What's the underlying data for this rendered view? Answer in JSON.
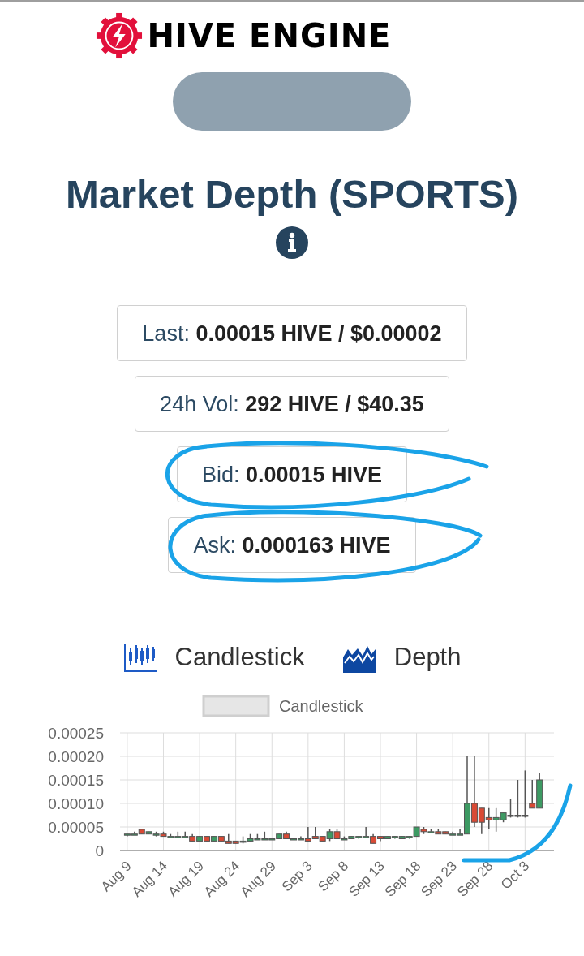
{
  "logo": {
    "text": "HIVE ENGINE"
  },
  "title": "Market Depth (SPORTS)",
  "stats": [
    {
      "text": "Last: **0.00015 HIVE / $0.00002**"
    },
    {
      "text": "24h Vol: **292 HIVE / $40.35**"
    },
    {
      "text": "Bid: **0.00015 HIVE**"
    },
    {
      "text": "Ask: **0.000163 HIVE**"
    }
  ],
  "chart_tabs": [
    {
      "label": "Candlestick",
      "kind": "candlestick"
    },
    {
      "label": "Depth",
      "kind": "depth"
    }
  ],
  "chart": {
    "legend": "Candlestick",
    "chart_data": {
      "type": "candlestick",
      "categories": [
        "Aug 9",
        null,
        null,
        null,
        null,
        "Aug 14",
        null,
        null,
        null,
        null,
        "Aug 19",
        null,
        null,
        null,
        null,
        "Aug 24",
        null,
        null,
        null,
        null,
        "Aug 29",
        null,
        null,
        null,
        null,
        "Sep 3",
        null,
        null,
        null,
        null,
        "Sep 8",
        null,
        null,
        null,
        null,
        "Sep 13",
        null,
        null,
        null,
        null,
        "Sep 18",
        null,
        null,
        null,
        null,
        "Sep 23",
        null,
        null,
        null,
        null,
        "Sep 28",
        null,
        null,
        null,
        null,
        "Oct 3",
        null,
        null
      ],
      "ohlc": [
        [
          3.5e-05,
          3.5e-05,
          3e-05,
          3.5e-05
        ],
        [
          3.5e-05,
          4e-05,
          3.5e-05,
          3.5e-05
        ],
        [
          4.5e-05,
          4.5e-05,
          3.5e-05,
          3.5e-05
        ],
        [
          3.5e-05,
          4e-05,
          3.5e-05,
          4e-05
        ],
        [
          3.5e-05,
          4e-05,
          3e-05,
          3.5e-05
        ],
        [
          3.5e-05,
          4e-05,
          3e-05,
          3e-05
        ],
        [
          3e-05,
          3.5e-05,
          3e-05,
          3e-05
        ],
        [
          3e-05,
          4e-05,
          3e-05,
          3e-05
        ],
        [
          3e-05,
          4e-05,
          3e-05,
          3e-05
        ],
        [
          3e-05,
          3.5e-05,
          2e-05,
          2e-05
        ],
        [
          2e-05,
          3e-05,
          2e-05,
          3e-05
        ],
        [
          3e-05,
          3e-05,
          2e-05,
          2e-05
        ],
        [
          2e-05,
          3e-05,
          2e-05,
          3e-05
        ],
        [
          3e-05,
          3e-05,
          2e-05,
          2e-05
        ],
        [
          2e-05,
          3.5e-05,
          1.5e-05,
          1.5e-05
        ],
        [
          2e-05,
          2e-05,
          1.5e-05,
          1.5e-05
        ],
        [
          2e-05,
          3e-05,
          1.5e-05,
          2e-05
        ],
        [
          2e-05,
          3.5e-05,
          2e-05,
          2.5e-05
        ],
        [
          2.5e-05,
          3.5e-05,
          2.5e-05,
          2.5e-05
        ],
        [
          2.5e-05,
          4e-05,
          2.5e-05,
          2.5e-05
        ],
        [
          2.5e-05,
          2.5e-05,
          2.5e-05,
          2.5e-05
        ],
        [
          2.5e-05,
          3.5e-05,
          2.5e-05,
          3.5e-05
        ],
        [
          3.5e-05,
          4e-05,
          2.5e-05,
          2.5e-05
        ],
        [
          2.5e-05,
          2.5e-05,
          2.5e-05,
          2.5e-05
        ],
        [
          2.5e-05,
          3e-05,
          2.5e-05,
          2.5e-05
        ],
        [
          2.5e-05,
          5e-05,
          2e-05,
          2e-05
        ],
        [
          3e-05,
          5e-05,
          2.5e-05,
          2.5e-05
        ],
        [
          3e-05,
          3e-05,
          2e-05,
          2e-05
        ],
        [
          2.5e-05,
          4.5e-05,
          2e-05,
          4e-05
        ],
        [
          4e-05,
          4.5e-05,
          2.5e-05,
          2.5e-05
        ],
        [
          2.5e-05,
          3e-05,
          2.5e-05,
          2.5e-05
        ],
        [
          2.5e-05,
          3e-05,
          2.5e-05,
          3e-05
        ],
        [
          3e-05,
          3e-05,
          2.5e-05,
          3e-05
        ],
        [
          3e-05,
          5e-05,
          3e-05,
          3e-05
        ],
        [
          3e-05,
          3.5e-05,
          1.5e-05,
          1.5e-05
        ],
        [
          3e-05,
          3e-05,
          2e-05,
          2.5e-05
        ],
        [
          2.5e-05,
          3e-05,
          2.5e-05,
          3e-05
        ],
        [
          3e-05,
          3e-05,
          2.5e-05,
          3e-05
        ],
        [
          2.5e-05,
          3e-05,
          2.5e-05,
          3e-05
        ],
        [
          3e-05,
          3e-05,
          2.5e-05,
          3e-05
        ],
        [
          3e-05,
          5e-05,
          3e-05,
          5e-05
        ],
        [
          4.5e-05,
          5e-05,
          3.5e-05,
          4e-05
        ],
        [
          4e-05,
          4.5e-05,
          4e-05,
          4e-05
        ],
        [
          4e-05,
          4.5e-05,
          3.5e-05,
          3.5e-05
        ],
        [
          4e-05,
          4e-05,
          3.5e-05,
          3.5e-05
        ],
        [
          3.5e-05,
          4e-05,
          3.5e-05,
          3.5e-05
        ],
        [
          3.5e-05,
          4.5e-05,
          3.5e-05,
          3.5e-05
        ],
        [
          3.5e-05,
          0.0002,
          3.5e-05,
          0.0001
        ],
        [
          0.0001,
          0.0002,
          5e-05,
          6e-05
        ],
        [
          9e-05,
          9e-05,
          3.5e-05,
          6e-05
        ],
        [
          7e-05,
          9e-05,
          4.5e-05,
          6.5e-05
        ],
        [
          6.5e-05,
          9e-05,
          4e-05,
          7e-05
        ],
        [
          6.5e-05,
          8e-05,
          6e-05,
          8e-05
        ],
        [
          7.5e-05,
          0.00011,
          7e-05,
          7.5e-05
        ],
        [
          7.5e-05,
          0.00015,
          7e-05,
          7.5e-05
        ],
        [
          7.5e-05,
          0.00017,
          7e-05,
          7.5e-05
        ],
        [
          0.0001,
          0.00015,
          9e-05,
          9e-05
        ],
        [
          9e-05,
          0.000165,
          9e-05,
          0.00015
        ]
      ],
      "grid": true,
      "ylim": [
        0,
        0.00025
      ],
      "yticks": [
        {
          "value": 0,
          "label": "0"
        },
        {
          "value": 5e-05,
          "label": "0.00005"
        },
        {
          "value": 0.0001,
          "label": "0.00010"
        },
        {
          "value": 0.00015,
          "label": "0.00015"
        },
        {
          "value": 0.0002,
          "label": "0.00020"
        },
        {
          "value": 0.00025,
          "label": "0.00025"
        }
      ]
    }
  }
}
